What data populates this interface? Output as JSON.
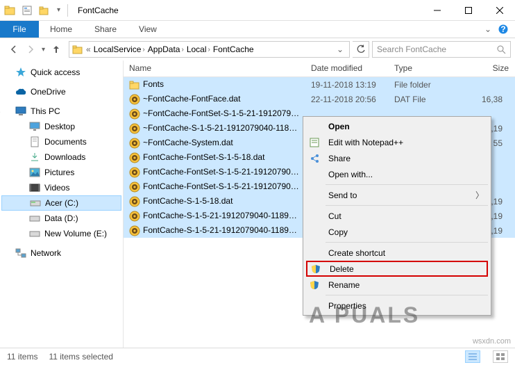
{
  "titlebar": {
    "title": "FontCache"
  },
  "ribbon": {
    "file": "File",
    "tabs": [
      "Home",
      "Share",
      "View"
    ]
  },
  "breadcrumb": {
    "items": [
      "LocalService",
      "AppData",
      "Local",
      "FontCache"
    ]
  },
  "search": {
    "placeholder": "Search FontCache"
  },
  "sidebar": {
    "quick_access": "Quick access",
    "onedrive": "OneDrive",
    "this_pc": "This PC",
    "children": [
      "Desktop",
      "Documents",
      "Downloads",
      "Pictures",
      "Videos",
      "Acer (C:)",
      "Data (D:)",
      "New Volume (E:)"
    ],
    "network": "Network"
  },
  "columns": {
    "name": "Name",
    "date": "Date modified",
    "type": "Type",
    "size": "Size"
  },
  "files": [
    {
      "icon": "folder",
      "name": "Fonts",
      "date": "19-11-2018 13:19",
      "type": "File folder",
      "size": ""
    },
    {
      "icon": "dat",
      "name": "~FontCache-FontFace.dat",
      "date": "22-11-2018 20:56",
      "type": "DAT File",
      "size": "16,38"
    },
    {
      "icon": "dat",
      "name": "~FontCache-FontSet-S-1-5-21-19120790...",
      "date": "",
      "type": "",
      "size": ""
    },
    {
      "icon": "dat",
      "name": "~FontCache-S-1-5-21-1912079040-11899...",
      "date": "",
      "type": "",
      "size": "8,19"
    },
    {
      "icon": "dat",
      "name": "~FontCache-System.dat",
      "date": "",
      "type": "",
      "size": "55"
    },
    {
      "icon": "dat",
      "name": "FontCache-FontSet-S-1-5-18.dat",
      "date": "",
      "type": "",
      "size": ""
    },
    {
      "icon": "dat",
      "name": "FontCache-FontSet-S-1-5-21-191207904...",
      "date": "",
      "type": "",
      "size": ""
    },
    {
      "icon": "dat",
      "name": "FontCache-FontSet-S-1-5-21-191207904...",
      "date": "",
      "type": "",
      "size": ""
    },
    {
      "icon": "dat",
      "name": "FontCache-S-1-5-18.dat",
      "date": "",
      "type": "",
      "size": "8,19"
    },
    {
      "icon": "dat",
      "name": "FontCache-S-1-5-21-1912079040-118993...",
      "date": "",
      "type": "",
      "size": "8,19"
    },
    {
      "icon": "dat",
      "name": "FontCache-S-1-5-21-1912079040-118993...",
      "date": "",
      "type": "",
      "size": "8,19"
    }
  ],
  "context_menu": {
    "open": "Open",
    "edit_npp": "Edit with Notepad++",
    "share": "Share",
    "open_with": "Open with...",
    "send_to": "Send to",
    "cut": "Cut",
    "copy": "Copy",
    "create_shortcut": "Create shortcut",
    "delete": "Delete",
    "rename": "Rename",
    "properties": "Properties"
  },
  "statusbar": {
    "count": "11 items",
    "selected": "11 items selected"
  },
  "watermark": {
    "logo": "A  PUALS",
    "site": "wsxdn.com"
  }
}
